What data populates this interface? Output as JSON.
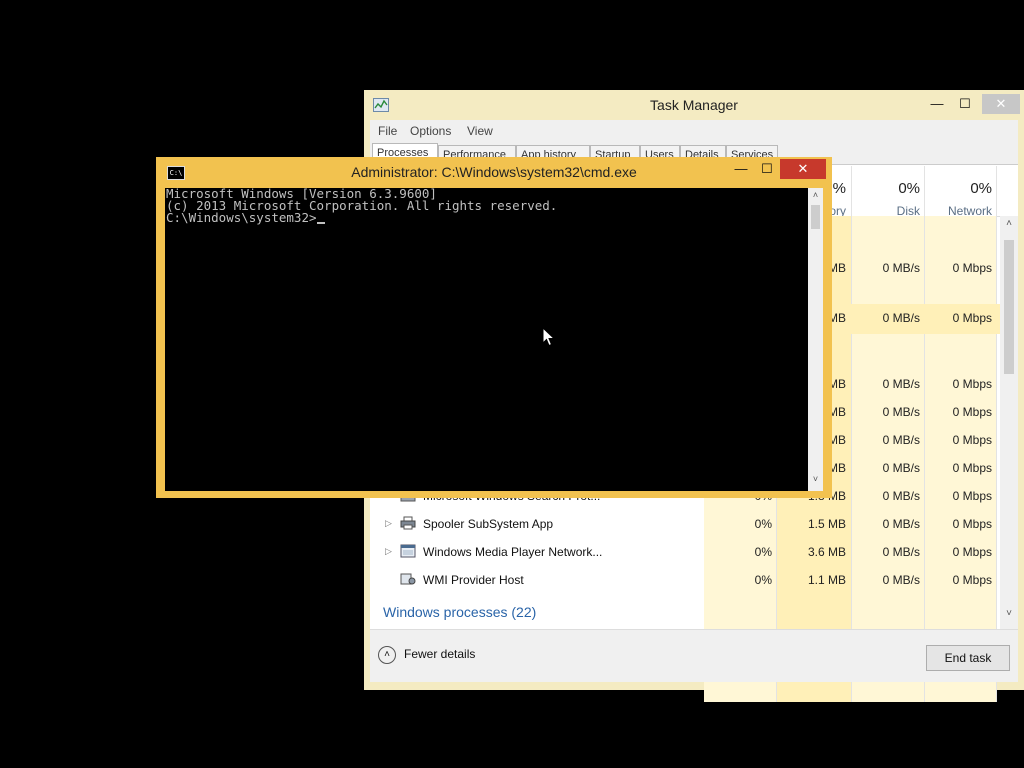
{
  "task_manager": {
    "title": "Task Manager",
    "menu": [
      "File",
      "Options",
      "View"
    ],
    "tabs": [
      "Processes",
      "Performance",
      "App history",
      "Startup",
      "Users",
      "Details",
      "Services"
    ],
    "columns": {
      "memory": {
        "pct": "%",
        "label": "ory"
      },
      "disk": {
        "pct": "0%",
        "label": "Disk"
      },
      "network": {
        "pct": "0%",
        "label": "Network"
      }
    },
    "partial_rows": [
      {
        "memory": "MB",
        "disk": "0 MB/s",
        "network": "0 Mbps"
      },
      {
        "memory": "MB",
        "disk": "0 MB/s",
        "network": "0 Mbps"
      },
      {
        "memory": "MB",
        "disk": "0 MB/s",
        "network": "0 Mbps"
      },
      {
        "memory": "MB",
        "disk": "0 MB/s",
        "network": "0 Mbps"
      },
      {
        "memory": "MB",
        "disk": "0 MB/s",
        "network": "0 Mbps"
      },
      {
        "memory": "MB",
        "disk": "0 MB/s",
        "network": "0 Mbps"
      }
    ],
    "rows": [
      {
        "name": "Microsoft Windows Search Prot...",
        "cpu": "0%",
        "memory": "1.8 MB",
        "disk": "0 MB/s",
        "network": "0 Mbps",
        "expandable": false
      },
      {
        "name": "Spooler SubSystem App",
        "cpu": "0%",
        "memory": "1.5 MB",
        "disk": "0 MB/s",
        "network": "0 Mbps",
        "expandable": true
      },
      {
        "name": "Windows Media Player Network...",
        "cpu": "0%",
        "memory": "3.6 MB",
        "disk": "0 MB/s",
        "network": "0 Mbps",
        "expandable": true
      },
      {
        "name": "WMI Provider Host",
        "cpu": "0%",
        "memory": "1.1 MB",
        "disk": "0 MB/s",
        "network": "0 Mbps",
        "expandable": false
      }
    ],
    "group_header": "Windows processes (22)",
    "fewer_details": "Fewer details",
    "end_task": "End task",
    "expand_glyph": "▷",
    "accent": "#2a64a8",
    "highlight": "#fff0b8"
  },
  "cmd": {
    "title": "Administrator: C:\\Windows\\system32\\cmd.exe",
    "icon_text": "C:\\",
    "lines": [
      "Microsoft Windows [Version 6.3.9600]",
      "(c) 2013 Microsoft Corporation. All rights reserved.",
      "",
      "C:\\Windows\\system32>"
    ],
    "border_color": "#f2c24f",
    "close_color": "#c7392c"
  },
  "glyphs": {
    "minimize": "—",
    "maximize": "☐",
    "close": "✕",
    "up": "˄",
    "down": "˅",
    "fewer": "˄"
  }
}
